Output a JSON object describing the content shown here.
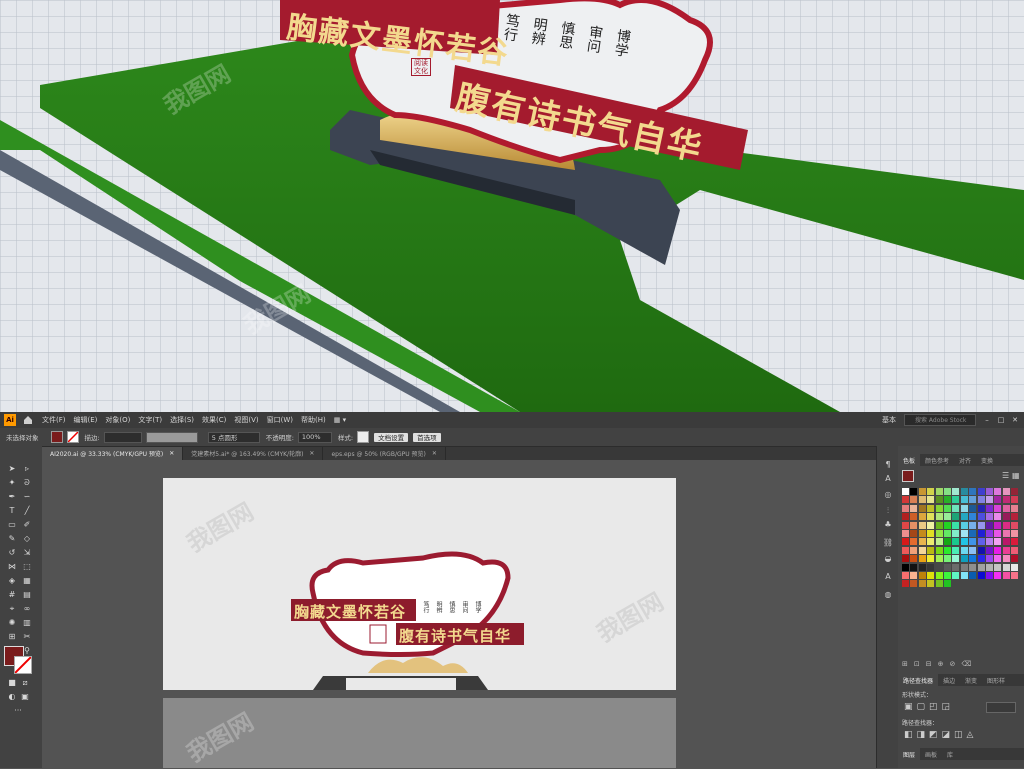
{
  "sign": {
    "line1": "胸藏文墨怀若谷",
    "line2": "腹有诗书气自华",
    "stamp": "阅读文化",
    "verticals": [
      "笃行",
      "明辨",
      "慎思",
      "审问",
      "博学"
    ]
  },
  "app": {
    "logo": "Ai",
    "menu": [
      "文件(F)",
      "编辑(E)",
      "对象(O)",
      "文字(T)",
      "选择(S)",
      "效果(C)",
      "视图(V)",
      "窗口(W)",
      "帮助(H)"
    ],
    "workspace": "基本",
    "stock_search": "搜索 Adobe Stock"
  },
  "controlbar": {
    "selection": "未选择对象",
    "stroke_label": "描边:",
    "brush": "5 点圆形",
    "opacity_label": "不透明度:",
    "opacity": "100%",
    "style_label": "样式:",
    "doc_setup": "文档设置",
    "preferences": "首选项"
  },
  "tabs": [
    {
      "label": "AI2020.ai @ 33.33% (CMYK/GPU 预览)",
      "active": true
    },
    {
      "label": "党建素材5.ai* @ 163.49% (CMYK/轮廓)",
      "active": false
    },
    {
      "label": "eps.eps @ 50% (RGB/GPU 预览)",
      "active": false
    }
  ],
  "panels": {
    "top_tabs": [
      "色板",
      "颜色参考",
      "对齐",
      "变换"
    ],
    "pathfinder_tabs": [
      "路径查找器",
      "描边",
      "渐变",
      "图形样"
    ],
    "shape_mode": "形状模式：",
    "pathfinder": "路径查找器：",
    "bottom_tabs": [
      "图层",
      "画板",
      "库"
    ]
  },
  "colors": {
    "accent": "#9b1b30",
    "gold": "#d9b96a",
    "fill": "#7a1c1c"
  },
  "watermark": "我图网"
}
